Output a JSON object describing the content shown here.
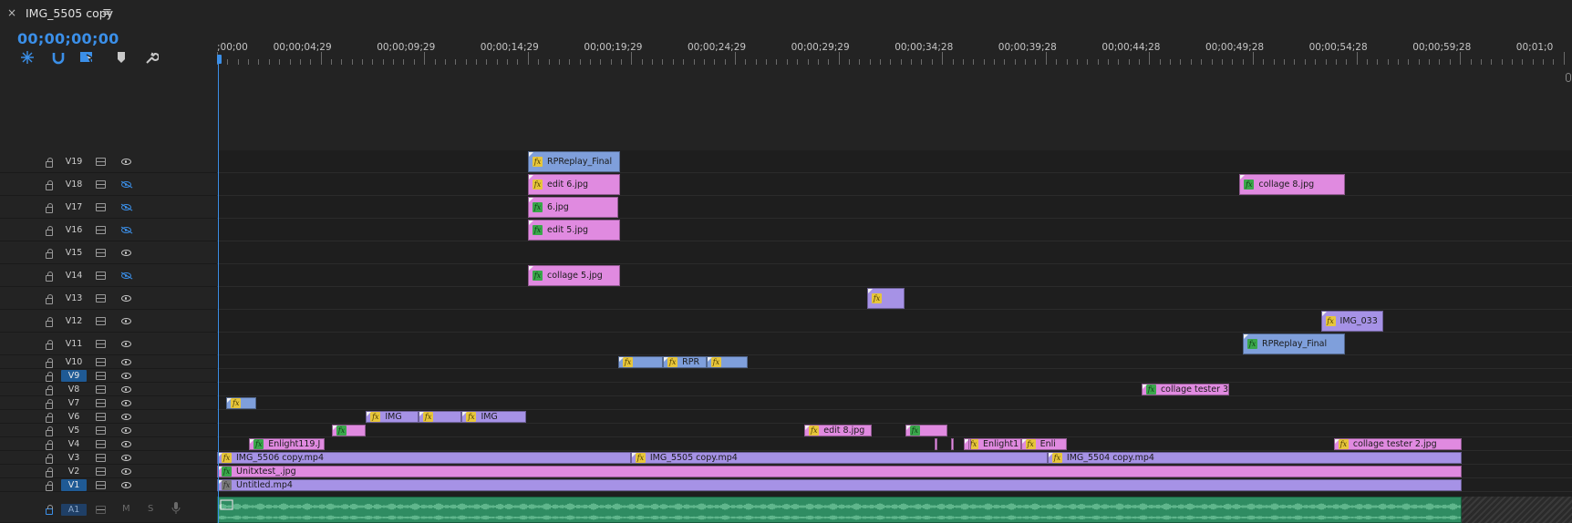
{
  "tab": {
    "title": "IMG_5505 copy",
    "close_glyph": "×",
    "menu_glyph": "≡"
  },
  "timecode": "00;00;00;00",
  "toolbar": [
    {
      "name": "snap-nested-icon"
    },
    {
      "name": "snap-magnet-icon"
    },
    {
      "name": "linked-selection-icon"
    },
    {
      "name": "add-marker-icon"
    },
    {
      "name": "wrench-icon"
    }
  ],
  "ruler_labels": [
    ";00;00",
    "00;00;04;29",
    "00;00;09;29",
    "00;00;14;29",
    "00;00;19;29",
    "00;00;24;29",
    "00;00;29;29",
    "00;00;34;28",
    "00;00;39;28",
    "00;00;44;28",
    "00;00;49;28",
    "00;00;54;28",
    "00;00;59;28",
    "00;01;0"
  ],
  "tracks": [
    {
      "name": "V19",
      "visible": true,
      "selected": false
    },
    {
      "name": "V18",
      "visible": false,
      "selected": false
    },
    {
      "name": "V17",
      "visible": false,
      "selected": false
    },
    {
      "name": "V16",
      "visible": false,
      "selected": false
    },
    {
      "name": "V15",
      "visible": true,
      "selected": false
    },
    {
      "name": "V14",
      "visible": false,
      "selected": false
    },
    {
      "name": "V13",
      "visible": true,
      "selected": false
    },
    {
      "name": "V12",
      "visible": true,
      "selected": false
    },
    {
      "name": "V11",
      "visible": true,
      "selected": false
    },
    {
      "name": "V10",
      "visible": true,
      "selected": false
    },
    {
      "name": "V9",
      "visible": true,
      "selected": true
    },
    {
      "name": "V8",
      "visible": true,
      "selected": false
    },
    {
      "name": "V7",
      "visible": true,
      "selected": false
    },
    {
      "name": "V6",
      "visible": true,
      "selected": false
    },
    {
      "name": "V5",
      "visible": true,
      "selected": false
    },
    {
      "name": "V4",
      "visible": true,
      "selected": false
    },
    {
      "name": "V3",
      "visible": true,
      "selected": false
    },
    {
      "name": "V2",
      "visible": true,
      "selected": false
    },
    {
      "name": "V1",
      "visible": true,
      "selected": true
    }
  ],
  "audio_track": {
    "name": "A1",
    "mute": "M",
    "solo": "S"
  },
  "clips": [
    {
      "track": "V19",
      "start": 14.99,
      "end": 19.45,
      "label": "RPReplay_Final",
      "color": "blue",
      "fx": "y"
    },
    {
      "track": "V18",
      "start": 14.99,
      "end": 19.45,
      "label": "edit 6.jpg",
      "color": "pink",
      "fx": "y"
    },
    {
      "track": "V18",
      "start": 49.29,
      "end": 54.36,
      "label": "collage 8.jpg",
      "color": "pink",
      "fx": "g"
    },
    {
      "track": "V17",
      "start": 14.99,
      "end": 19.36,
      "label": "6.jpg",
      "color": "pink",
      "fx": "g"
    },
    {
      "track": "V16",
      "start": 14.99,
      "end": 19.45,
      "label": "edit 5.jpg",
      "color": "pink",
      "fx": "g"
    },
    {
      "track": "V14",
      "start": 14.99,
      "end": 19.45,
      "label": "collage 5.jpg",
      "color": "pink",
      "fx": "g"
    },
    {
      "track": "V13",
      "start": 31.34,
      "end": 33.15,
      "label": "",
      "color": "purple",
      "fx": "y"
    },
    {
      "track": "V12",
      "start": 53.21,
      "end": 56.24,
      "label": "IMG_033",
      "color": "purple",
      "fx": "y"
    },
    {
      "track": "V11",
      "start": 49.45,
      "end": 54.36,
      "label": "RPReplay_Final",
      "color": "blue",
      "fx": "g"
    },
    {
      "track": "V10",
      "start": 19.34,
      "end": 21.5,
      "label": "",
      "color": "blue",
      "fx": "y"
    },
    {
      "track": "V10",
      "start": 21.5,
      "end": 23.6,
      "label": "RPR",
      "color": "blue",
      "fx": "y"
    },
    {
      "track": "V10",
      "start": 23.6,
      "end": 25.6,
      "label": "",
      "color": "blue",
      "fx": "y"
    },
    {
      "track": "V8",
      "start": 44.57,
      "end": 48.77,
      "label": "collage tester 3",
      "color": "pink",
      "fx": "g"
    },
    {
      "track": "V7",
      "start": 0.45,
      "end": 1.9,
      "label": "",
      "color": "blue",
      "fx": "y"
    },
    {
      "track": "V6",
      "start": 7.18,
      "end": 9.72,
      "label": "IMG",
      "color": "purple",
      "fx": "y"
    },
    {
      "track": "V6",
      "start": 9.72,
      "end": 11.8,
      "label": "",
      "color": "purple",
      "fx": "y"
    },
    {
      "track": "V6",
      "start": 11.8,
      "end": 14.92,
      "label": "IMG",
      "color": "purple",
      "fx": "y"
    },
    {
      "track": "V5",
      "start": 5.54,
      "end": 7.18,
      "label": "",
      "color": "pink",
      "fx": "g"
    },
    {
      "track": "V5",
      "start": 28.32,
      "end": 31.58,
      "label": "edit 8.jpg",
      "color": "pink",
      "fx": "y"
    },
    {
      "track": "V5",
      "start": 33.18,
      "end": 35.2,
      "label": "",
      "color": "pink",
      "fx": "g"
    },
    {
      "track": "V4",
      "start": 1.55,
      "end": 5.2,
      "label": "Enlight119.J",
      "color": "pink",
      "fx": "g"
    },
    {
      "track": "V4",
      "start": 36.0,
      "end": 38.75,
      "label": "Enlight1",
      "color": "pink",
      "fx": "y"
    },
    {
      "track": "V4",
      "start": 38.75,
      "end": 40.95,
      "label": "Enli",
      "color": "pink",
      "fx": "y"
    },
    {
      "track": "V4",
      "start": 53.84,
      "end": 60.0,
      "label": "collage tester 2.jpg",
      "color": "pink",
      "fx": "y"
    },
    {
      "track": "V3",
      "start": 0.0,
      "end": 19.95,
      "label": "IMG_5506 copy.mp4",
      "color": "purple",
      "fx": "y"
    },
    {
      "track": "V3",
      "start": 19.95,
      "end": 40.04,
      "label": "IMG_5505 copy.mp4",
      "color": "purple",
      "fx": "y"
    },
    {
      "track": "V3",
      "start": 40.04,
      "end": 60.0,
      "label": "IMG_5504 copy.mp4",
      "color": "purple",
      "fx": "y"
    },
    {
      "track": "V2",
      "start": 0.0,
      "end": 60.0,
      "label": "Unitxtest_.jpg",
      "color": "pink",
      "fx": "g"
    },
    {
      "track": "V1",
      "start": 0.0,
      "end": 60.0,
      "label": "Untitled.mp4",
      "color": "purple",
      "fx": "gr"
    }
  ],
  "v5_small_clips": [
    {
      "start": 34.6,
      "end": 34.75
    },
    {
      "start": 35.4,
      "end": 35.55
    },
    {
      "start": 36.2,
      "end": 36.35
    }
  ],
  "colors": {
    "accent": "#3b8fe8",
    "pink": "#e08ae0",
    "blue": "#7f9fdb",
    "purple": "#a692e6",
    "audio": "#2f8c62",
    "fx_yellow": "#e7c63b",
    "fx_green": "#3aa74b"
  }
}
